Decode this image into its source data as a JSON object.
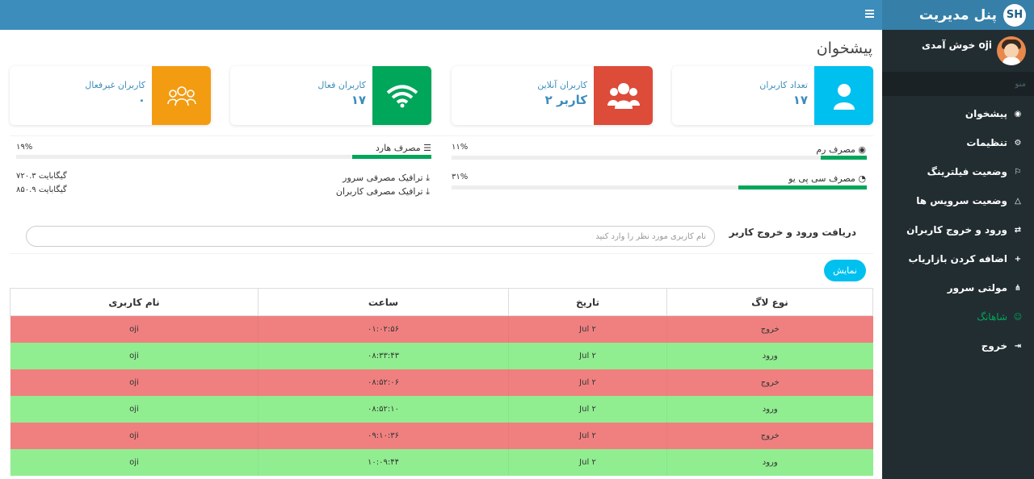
{
  "brand": {
    "title": "پنل مدیریت",
    "logo_text": "SH"
  },
  "user": {
    "welcome": "خوش آمدی oji"
  },
  "sidebar": {
    "menu_header": "منو",
    "items": [
      {
        "label": "پیشخوان",
        "icon": "dashboard-icon",
        "glyph": "◉"
      },
      {
        "label": "تنظیمات",
        "icon": "gear-icon",
        "glyph": "⚙"
      },
      {
        "label": "وضعیت فیلترینگ",
        "icon": "flag-icon",
        "glyph": "⚐"
      },
      {
        "label": "وضعیت سرویس ها",
        "icon": "linux-icon",
        "glyph": "△"
      },
      {
        "label": "ورود و خروج کاربران",
        "icon": "shuffle-icon",
        "glyph": "⇄"
      },
      {
        "label": "اضافه کردن بازاریاب",
        "icon": "plus-icon",
        "glyph": "+"
      },
      {
        "label": "مولتی سرور",
        "icon": "sitemap-icon",
        "glyph": "⋔"
      },
      {
        "label": "شاهانگ",
        "icon": "smile-icon",
        "glyph": "☺"
      },
      {
        "label": "خروج",
        "icon": "sign-out-icon",
        "glyph": "⇥"
      }
    ]
  },
  "page": {
    "title": "پیشخوان"
  },
  "boxes": [
    {
      "label": "تعداد کاربران",
      "value": "۱۷",
      "color": "#00c0ef",
      "icon": "user-icon"
    },
    {
      "label": "کاربران آنلاین",
      "value": "۲ کاربر",
      "color": "#dd4b39",
      "icon": "users-icon"
    },
    {
      "label": "کاربران فعال",
      "value": "۱۷",
      "color": "#00a65a",
      "icon": "wifi-icon"
    },
    {
      "label": "کاربران غیرفعال",
      "value": "۰",
      "color": "#f39c12",
      "icon": "users-outline-icon"
    }
  ],
  "stats": {
    "ram": {
      "label": "مصرف رم",
      "percent_text": "۱۱%",
      "value": 0.11
    },
    "cpu": {
      "label": "مصرف سی پی یو",
      "percent_text": "۳۱%",
      "value": 0.31
    },
    "disk": {
      "label": "مصرف هارد",
      "percent_text": "۱۹%",
      "value": 0.19
    },
    "server_traffic": {
      "label": "ترافیک مصرفی سرور",
      "value": "۷۲۰.۳ گیگابایت"
    },
    "user_traffic": {
      "label": "ترافیک مصرفی کاربران",
      "value": "۸۵۰.۹ گیگابایت"
    }
  },
  "filter": {
    "label": "دریافت ورود و خروج کاربر",
    "placeholder": "نام کاربری مورد نظر را وارد کنید",
    "button": "نمایش"
  },
  "table": {
    "headers": [
      "نوع لاگ",
      "تاریخ",
      "ساعت",
      "نام کاربری"
    ],
    "rows": [
      {
        "type": "خروج",
        "date": "۲ Jul",
        "time": "۰۱:۰۲:۵۶",
        "user": "oji"
      },
      {
        "type": "ورود",
        "date": "۲ Jul",
        "time": "۰۸:۳۳:۴۳",
        "user": "oji"
      },
      {
        "type": "خروج",
        "date": "۲ Jul",
        "time": "۰۸:۵۲:۰۶",
        "user": "oji"
      },
      {
        "type": "ورود",
        "date": "۲ Jul",
        "time": "۰۸:۵۲:۱۰",
        "user": "oji"
      },
      {
        "type": "خروج",
        "date": "۲ Jul",
        "time": "۰۹:۱۰:۳۶",
        "user": "oji"
      },
      {
        "type": "ورود",
        "date": "۲ Jul",
        "time": "۱۰:۰۹:۴۴",
        "user": "oji"
      }
    ]
  }
}
